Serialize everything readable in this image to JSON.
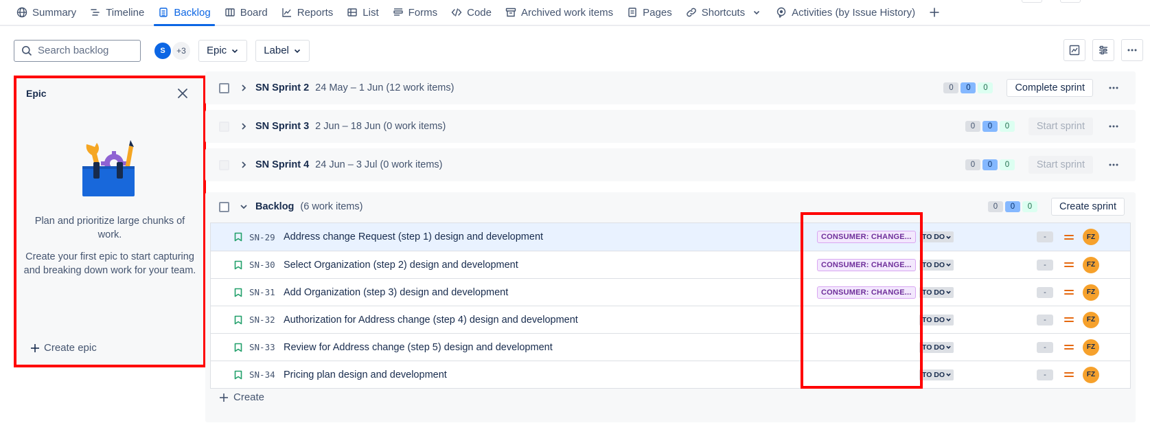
{
  "nav": {
    "tabs": [
      {
        "label": "Summary",
        "icon": "globe-icon"
      },
      {
        "label": "Timeline",
        "icon": "timeline-icon"
      },
      {
        "label": "Backlog",
        "icon": "backlog-icon",
        "active": true
      },
      {
        "label": "Board",
        "icon": "board-icon"
      },
      {
        "label": "Reports",
        "icon": "chart-line-icon"
      },
      {
        "label": "List",
        "icon": "list-icon"
      },
      {
        "label": "Forms",
        "icon": "forms-icon"
      },
      {
        "label": "Code",
        "icon": "code-icon"
      },
      {
        "label": "Archived work items",
        "icon": "archive-icon"
      },
      {
        "label": "Pages",
        "icon": "page-icon"
      },
      {
        "label": "Shortcuts",
        "icon": "link-icon"
      },
      {
        "label": "Activities (by Issue History)",
        "icon": "activities-icon"
      }
    ],
    "accent": "#0c66e4"
  },
  "toolbar": {
    "search_placeholder": "Search backlog",
    "avatar_initial": "S",
    "avatar_more": "+3",
    "filter_epic": "Epic",
    "filter_label": "Label"
  },
  "epic_panel": {
    "title": "Epic",
    "desc1": "Plan and prioritize large chunks of work.",
    "desc2": "Create your first epic to start capturing and breaking down work for your team.",
    "create_label": "Create epic"
  },
  "sprints": [
    {
      "name": "SN Sprint 2",
      "meta": "24 May – 1 Jun (12 work items)",
      "counts": [
        "0",
        "0",
        "0"
      ],
      "action": "Complete sprint",
      "action_enabled": true
    },
    {
      "name": "SN Sprint 3",
      "meta": "2 Jun – 18 Jun (0 work items)",
      "counts": [
        "0",
        "0",
        "0"
      ],
      "action": "Start sprint",
      "action_enabled": false
    },
    {
      "name": "SN Sprint 4",
      "meta": "24 Jun – 3 Jul (0 work items)",
      "counts": [
        "0",
        "0",
        "0"
      ],
      "action": "Start sprint",
      "action_enabled": false
    }
  ],
  "backlog": {
    "name": "Backlog",
    "meta": "(6 work items)",
    "counts": [
      "0",
      "0",
      "0"
    ],
    "action": "Create sprint",
    "create_label": "Create",
    "items": [
      {
        "key": "SN-29",
        "summary": "Address change Request (step 1) design and development",
        "label": "CONSUMER: CHANGE...",
        "status": "TO DO",
        "estimate": "-",
        "assignee": "FZ"
      },
      {
        "key": "SN-30",
        "summary": "Select Organization (step 2) design and development",
        "label": "CONSUMER: CHANGE...",
        "status": "TO DO",
        "estimate": "-",
        "assignee": "FZ"
      },
      {
        "key": "SN-31",
        "summary": "Add Organization (step 3) design and development",
        "label": "CONSUMER: CHANGE...",
        "status": "TO DO",
        "estimate": "-",
        "assignee": "FZ"
      },
      {
        "key": "SN-32",
        "summary": "Authorization for Address change (step 4) design and development",
        "label": "",
        "status": "TO DO",
        "estimate": "-",
        "assignee": "FZ"
      },
      {
        "key": "SN-33",
        "summary": "Review for Address change (step 5) design and development",
        "label": "",
        "status": "TO DO",
        "estimate": "-",
        "assignee": "FZ"
      },
      {
        "key": "SN-34",
        "summary": "Pricing plan design and development",
        "label": "",
        "status": "TO DO",
        "estimate": "-",
        "assignee": "FZ"
      }
    ]
  },
  "colors": {
    "highlight_box": "#ff0000",
    "label_purple": "#6e2e9a",
    "priority_medium": "#e56910",
    "assignee_bg": "#f6a12c",
    "story_green": "#22a06b"
  }
}
